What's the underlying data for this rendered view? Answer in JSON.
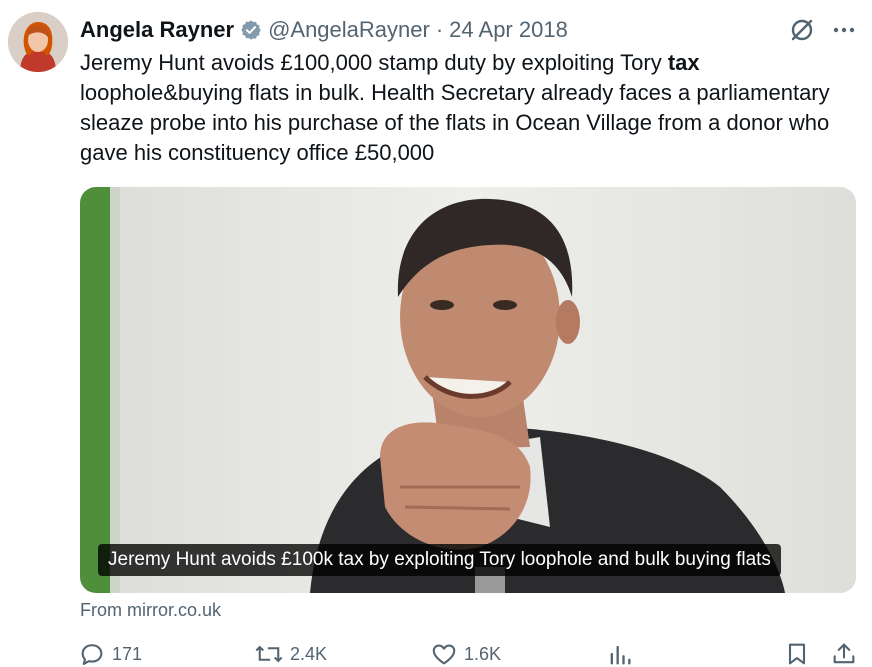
{
  "author": {
    "name": "Angela Rayner",
    "handle": "@AngelaRayner",
    "separator": "·",
    "date": "24 Apr 2018",
    "verified_icon": "verified-badge-icon"
  },
  "tweet": {
    "text_part1": "Jeremy Hunt avoids £100,000 stamp duty by exploiting Tory ",
    "text_bold": "tax",
    "text_part2": " loophole&buying flats in bulk. Health Secretary already faces a parliamentary sleaze probe into his purchase of the flats in Ocean Village from a donor who gave his constituency office £50,000"
  },
  "media": {
    "caption": "Jeremy Hunt avoids £100k tax by exploiting Tory loophole and bulk buying flats"
  },
  "source": "From mirror.co.uk",
  "actions": {
    "replies": "171",
    "retweets": "2.4K",
    "likes": "1.6K"
  },
  "colors": {
    "text": "#0f1419",
    "secondary": "#536471",
    "verified": "#829aab"
  }
}
